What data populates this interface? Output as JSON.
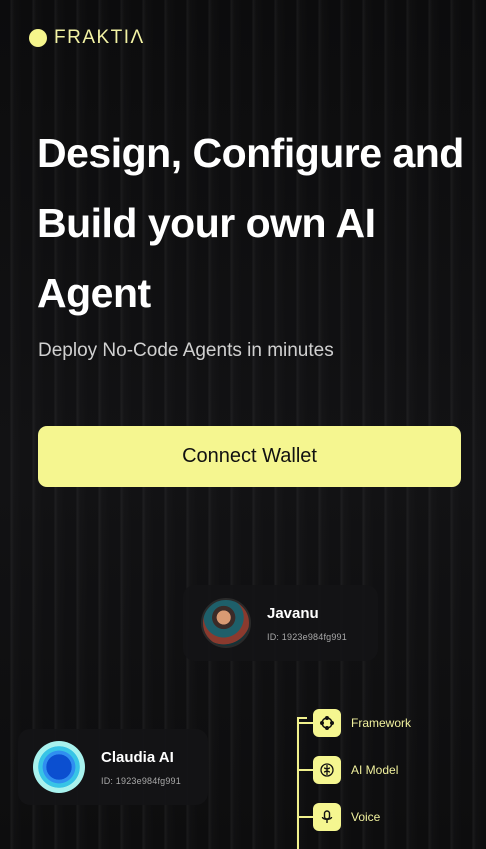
{
  "brand": {
    "name": "FRAKTIΛ"
  },
  "hero": {
    "headline_line1": "Design, Configure and",
    "headline_line2": "Build your own AI",
    "headline_line3": "Agent",
    "subheadline": "Deploy No-Code Agents in minutes"
  },
  "cta": {
    "label": "Connect Wallet"
  },
  "agents": [
    {
      "name": "Javanu",
      "id": "ID: 1923e984fg991"
    },
    {
      "name": "Claudia AI",
      "id": "ID: 1923e984fg991"
    }
  ],
  "config_tree": [
    {
      "label": "Framework",
      "icon": "framework-icon"
    },
    {
      "label": "AI Model",
      "icon": "brain-icon"
    },
    {
      "label": "Voice",
      "icon": "microphone-icon"
    }
  ],
  "colors": {
    "accent": "#f5f690",
    "background": "#0b0b0c"
  }
}
